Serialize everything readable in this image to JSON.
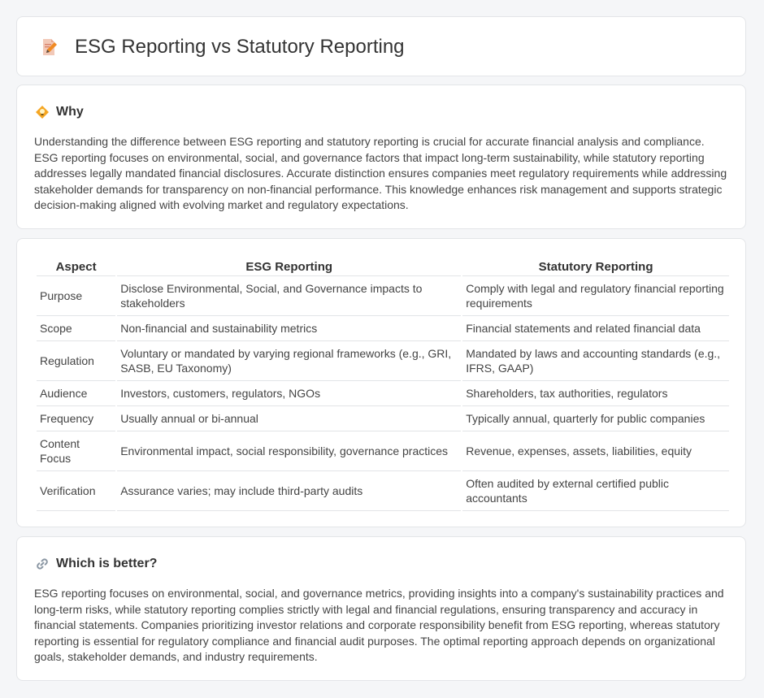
{
  "header": {
    "title": "ESG Reporting vs Statutory Reporting",
    "icon": "document-edit-icon"
  },
  "why": {
    "title": "Why",
    "icon": "lightbulb-icon",
    "body": "Understanding the difference between ESG reporting and statutory reporting is crucial for accurate financial analysis and compliance. ESG reporting focuses on environmental, social, and governance factors that impact long-term sustainability, while statutory reporting addresses legally mandated financial disclosures. Accurate distinction ensures companies meet regulatory requirements while addressing stakeholder demands for transparency on non-financial performance. This knowledge enhances risk management and supports strategic decision-making aligned with evolving market and regulatory expectations."
  },
  "table": {
    "headers": [
      "Aspect",
      "ESG Reporting",
      "Statutory Reporting"
    ],
    "rows": [
      [
        "Purpose",
        "Disclose Environmental, Social, and Governance impacts to stakeholders",
        "Comply with legal and regulatory financial reporting requirements"
      ],
      [
        "Scope",
        "Non-financial and sustainability metrics",
        "Financial statements and related financial data"
      ],
      [
        "Regulation",
        "Voluntary or mandated by varying regional frameworks (e.g., GRI, SASB, EU Taxonomy)",
        "Mandated by laws and accounting standards (e.g., IFRS, GAAP)"
      ],
      [
        "Audience",
        "Investors, customers, regulators, NGOs",
        "Shareholders, tax authorities, regulators"
      ],
      [
        "Frequency",
        "Usually annual or bi-annual",
        "Typically annual, quarterly for public companies"
      ],
      [
        "Content Focus",
        "Environmental impact, social responsibility, governance practices",
        "Revenue, expenses, assets, liabilities, equity"
      ],
      [
        "Verification",
        "Assurance varies; may include third-party audits",
        "Often audited by external certified public accountants"
      ]
    ]
  },
  "better": {
    "title": "Which is better?",
    "icon": "link-icon",
    "body": "ESG reporting focuses on environmental, social, and governance metrics, providing insights into a company's sustainability practices and long-term risks, while statutory reporting complies strictly with legal and financial regulations, ensuring transparency and accuracy in financial statements. Companies prioritizing investor relations and corporate responsibility benefit from ESG reporting, whereas statutory reporting is essential for regulatory compliance and financial audit purposes. The optimal reporting approach depends on organizational goals, stakeholder demands, and industry requirements."
  }
}
